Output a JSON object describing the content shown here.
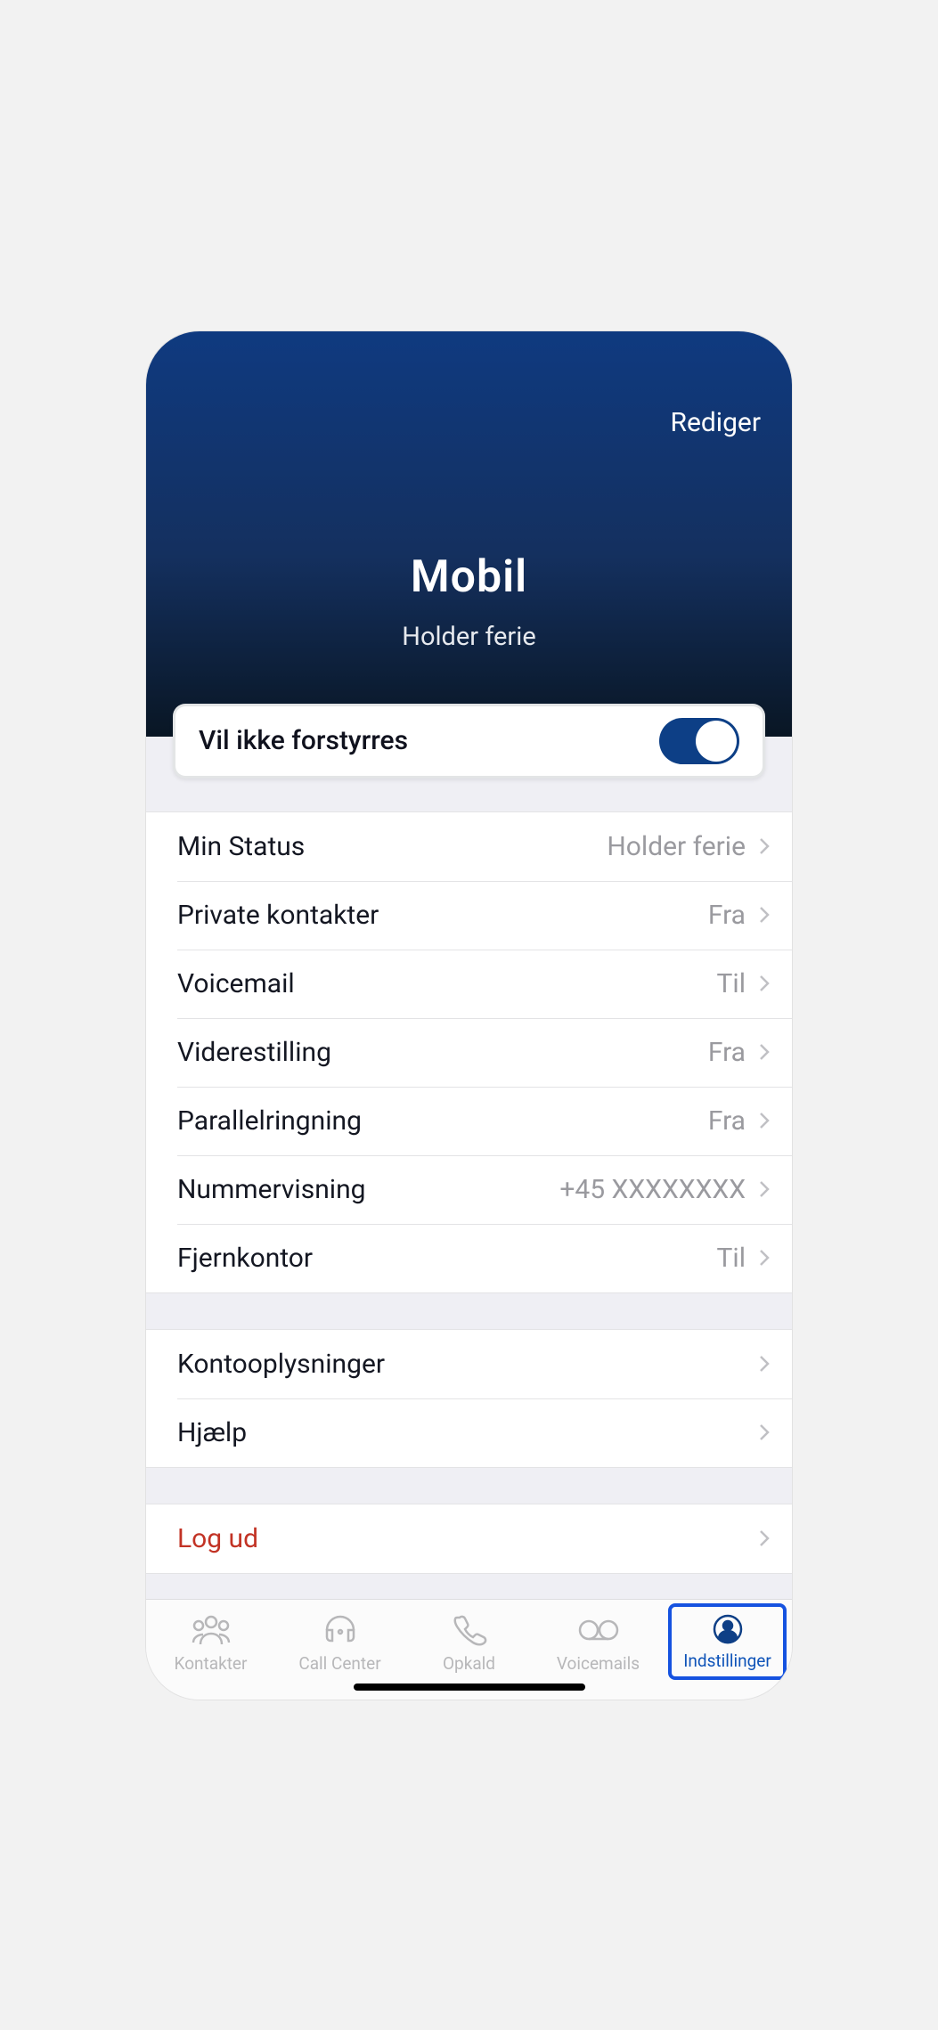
{
  "header": {
    "edit_label": "Rediger",
    "title": "Mobil",
    "subtitle": "Holder ferie"
  },
  "dnd": {
    "label": "Vil ikke forstyrres",
    "on": true
  },
  "settings": [
    {
      "label": "Min Status",
      "value": "Holder ferie"
    },
    {
      "label": "Private kontakter",
      "value": "Fra"
    },
    {
      "label": "Voicemail",
      "value": "Til"
    },
    {
      "label": "Viderestilling",
      "value": "Fra"
    },
    {
      "label": "Parallelringning",
      "value": "Fra"
    },
    {
      "label": "Nummervisning",
      "value": "+45 XXXXXXXX"
    },
    {
      "label": "Fjernkontor",
      "value": "Til"
    }
  ],
  "secondary": [
    {
      "label": "Kontooplysninger"
    },
    {
      "label": "Hjælp"
    }
  ],
  "logout": {
    "label": "Log ud"
  },
  "tabs": [
    {
      "label": "Kontakter"
    },
    {
      "label": "Call Center"
    },
    {
      "label": "Opkald"
    },
    {
      "label": "Voicemails"
    },
    {
      "label": "Indstillinger"
    }
  ]
}
